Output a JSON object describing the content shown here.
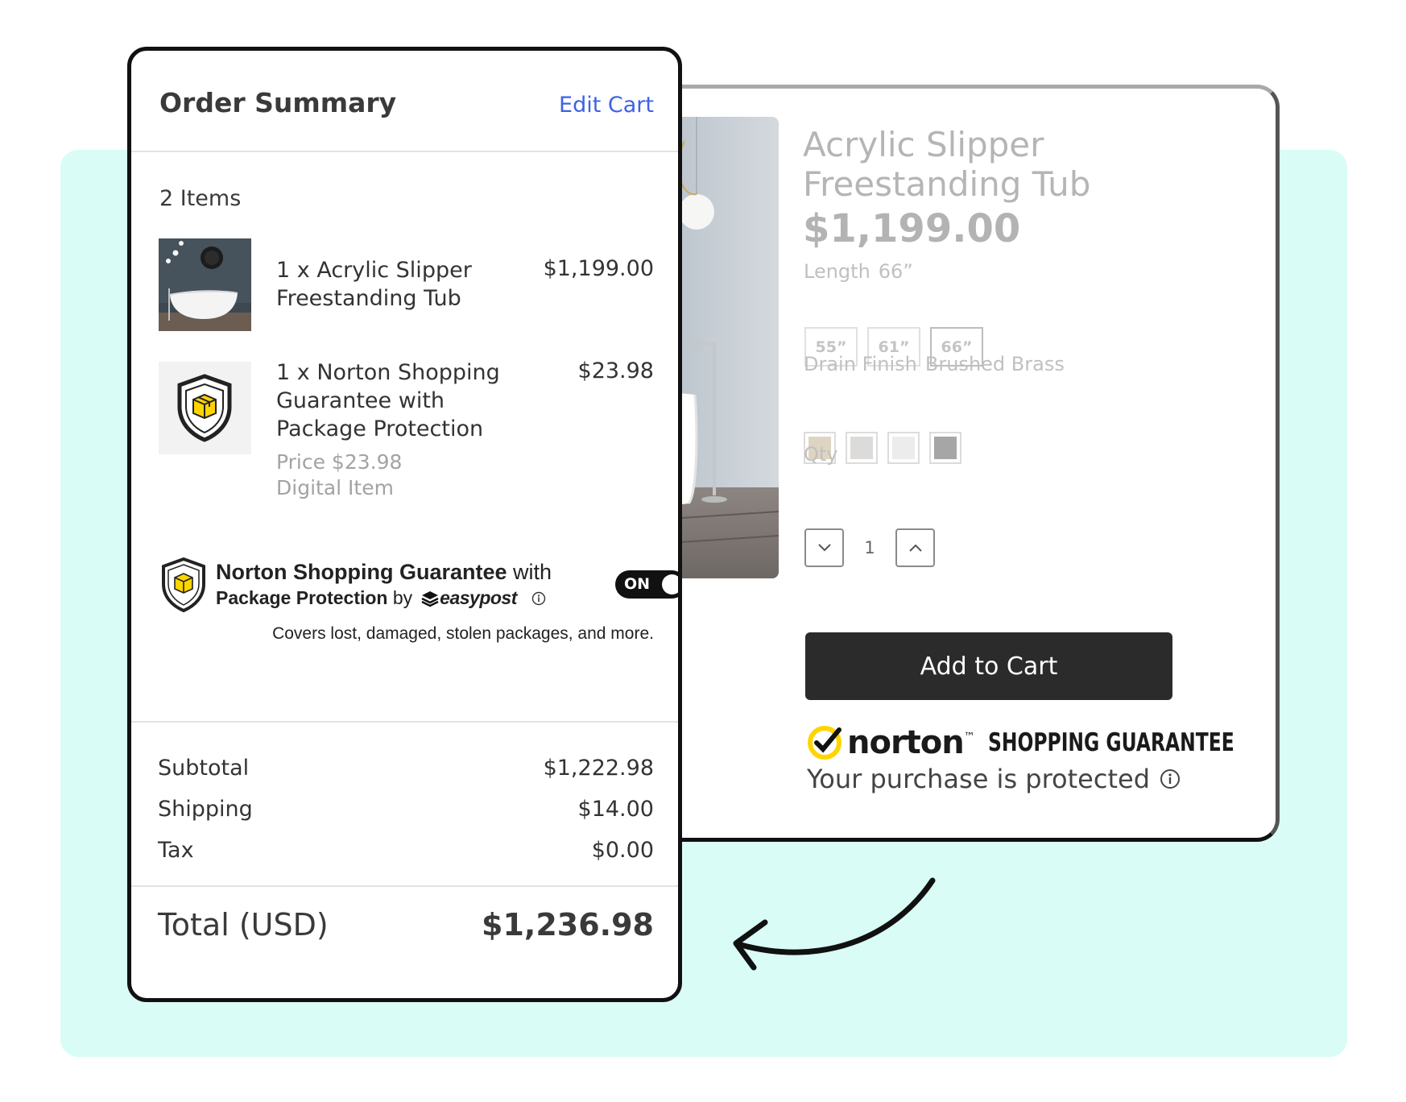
{
  "product": {
    "title": "Acrylic Slipper Freestanding Tub",
    "price": "$1,199.00",
    "length_label": "Length",
    "length_value": "66”",
    "lengths": [
      "55”",
      "61”",
      "66”"
    ],
    "drain_label": "Drain Finish",
    "drain_value": "Brushed Brass",
    "swatch_colors": [
      "#ddd5c1",
      "#dcdbd9",
      "#ececec",
      "#a6a6a6"
    ],
    "qty_label": "Qty",
    "qty_value": "1",
    "add_to_cart": "Add to Cart",
    "norton_brand": "norton",
    "norton_tm": "™",
    "norton_tagline": "SHOPPING GUARANTEE",
    "protected_text": "Your purchase is protected",
    "norton_check_color": "#ffd400"
  },
  "order": {
    "title": "Order Summary",
    "edit_cart": "Edit Cart",
    "items_count": "2 Items",
    "items": [
      {
        "name": "1 x Acrylic Slipper Freestanding Tub",
        "price": "$1,199.00",
        "icon": "bathtub-photo"
      },
      {
        "name": "1 x Norton Shopping Guarantee with Package Protection",
        "price": "$23.98",
        "meta_price": "Price $23.98",
        "meta_type": "Digital Item",
        "icon": "shield-package-icon"
      }
    ],
    "guarantee": {
      "bold1": "Norton Shopping Guarantee",
      "plain1": " with",
      "bold2": "Package Protection",
      "plain2": " by",
      "easypost": "easypost",
      "toggle": "ON",
      "covers": "Covers lost, damaged, stolen packages, and more."
    },
    "subtotal_label": "Subtotal",
    "subtotal": "$1,222.98",
    "shipping_label": "Shipping",
    "shipping": "$14.00",
    "tax_label": "Tax",
    "tax": "$0.00",
    "total_label": "Total (USD)",
    "total": "$1,236.98",
    "accent_link": "#3f62e3"
  },
  "background_color": "#d9fcf6"
}
